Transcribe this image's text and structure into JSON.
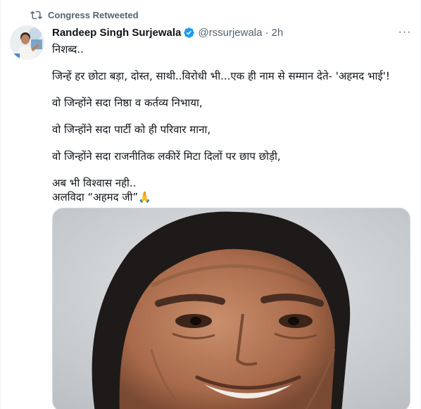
{
  "social_context": {
    "label": "Congress Retweeted",
    "icon": "retweet-icon"
  },
  "author": {
    "display_name": "Randeep Singh Surjewala",
    "verified": true,
    "verified_color": "#1d9bf0",
    "handle": "@rssurjewala",
    "separator": "·",
    "time": "2h"
  },
  "more_label": "···",
  "tweet": {
    "line1": "निशब्द..",
    "line2": "जिन्हें हर छोटा बड़ा, दोस्त, साथी..विरोधी भी...एक ही नाम से सम्मान देते- 'अहमद भाई'!",
    "line3": "वो जिन्होंने सदा निष्ठा व कर्तव्य निभाया,",
    "line4": "वो जिन्होंने सदा पार्टी को ही परिवार माना,",
    "line5": "वो जिन्होंने सदा राजनीतिक लकीरें मिटा दिलों पर छाप छोड़ी,",
    "line6": "अब भी विश्वास नही..",
    "line7": "अलविदा “अहमद जी”🙏"
  },
  "colors": {
    "text": "#0f1419",
    "secondary": "#536471",
    "accent": "#1d9bf0"
  }
}
